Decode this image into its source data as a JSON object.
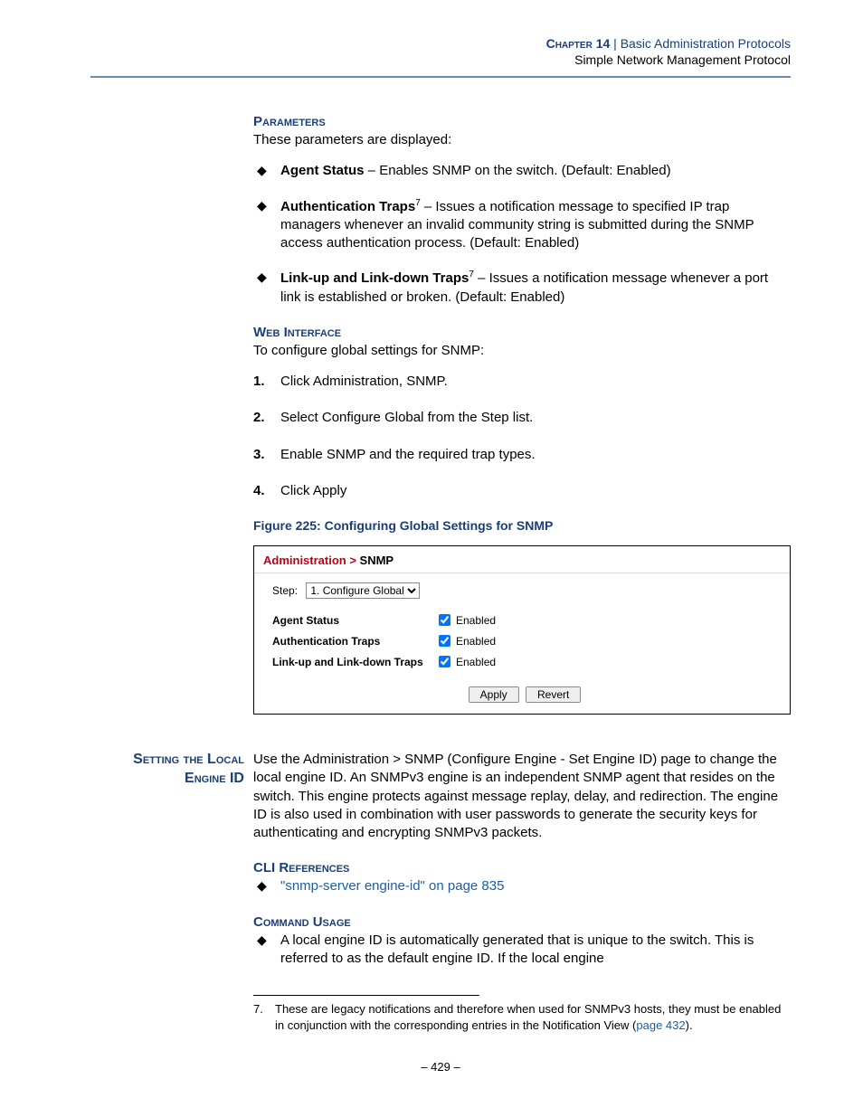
{
  "header": {
    "chapter": "Chapter 14",
    "sep": "  |  ",
    "title1": "Basic Administration Protocols",
    "title2": "Simple Network Management Protocol"
  },
  "sec1": {
    "heading": "Parameters",
    "intro": "These parameters are displayed:",
    "items": [
      {
        "bold": "Agent Status",
        "sup": "",
        "text": " – Enables SNMP on the switch. (Default: Enabled)"
      },
      {
        "bold": "Authentication Traps",
        "sup": "7",
        "text": " – Issues a notification message to specified IP trap managers whenever an invalid community string is submitted during the SNMP access authentication process. (Default: Enabled)"
      },
      {
        "bold": "Link-up and Link-down Traps",
        "sup": "7",
        "text": " – Issues a notification message whenever a port link is established or broken. (Default: Enabled)"
      }
    ]
  },
  "sec2": {
    "heading": "Web Interface",
    "intro": "To configure global settings for SNMP:",
    "steps": [
      "Click Administration, SNMP.",
      "Select Configure Global from the Step list.",
      "Enable SNMP and the required trap types.",
      "Click Apply"
    ],
    "nums": [
      "1.",
      "2.",
      "3.",
      "4."
    ]
  },
  "figure": {
    "caption": "Figure 225:  Configuring Global Settings for SNMP",
    "breadcrumb1": "Administration > ",
    "breadcrumb2": "SNMP",
    "stepLabel": "Step:",
    "stepOption": "1. Configure Global",
    "rows": [
      {
        "label": "Agent Status",
        "value": "Enabled"
      },
      {
        "label": "Authentication Traps",
        "value": "Enabled"
      },
      {
        "label": "Link-up and Link-down Traps",
        "value": "Enabled"
      }
    ],
    "applyBtn": "Apply",
    "revertBtn": "Revert"
  },
  "sec3": {
    "sideTitle": "Setting the Local Engine ID",
    "body": "Use the Administration > SNMP (Configure Engine - Set Engine ID) page to change the local engine ID. An SNMPv3 engine is an independent SNMP agent that resides on the switch. This engine protects against message replay, delay, and redirection. The engine ID is also used in combination with user passwords to generate the security keys for authenticating and encrypting SNMPv3 packets."
  },
  "cliRefs": {
    "heading": "CLI References",
    "link": "\"snmp-server engine-id\" on page 835"
  },
  "cmdUsage": {
    "heading": "Command Usage",
    "item": "A local engine ID is automatically generated that is unique to the switch. This is referred to as the default engine ID. If the local engine"
  },
  "footnote": {
    "num": "7.",
    "text1": "These are legacy notifications and therefore when used for SNMPv3 hosts, they must be enabled in conjunction with the corresponding entries in the Notification View (",
    "link": "page 432",
    "text2": ")."
  },
  "pagenum": "–  429  –"
}
